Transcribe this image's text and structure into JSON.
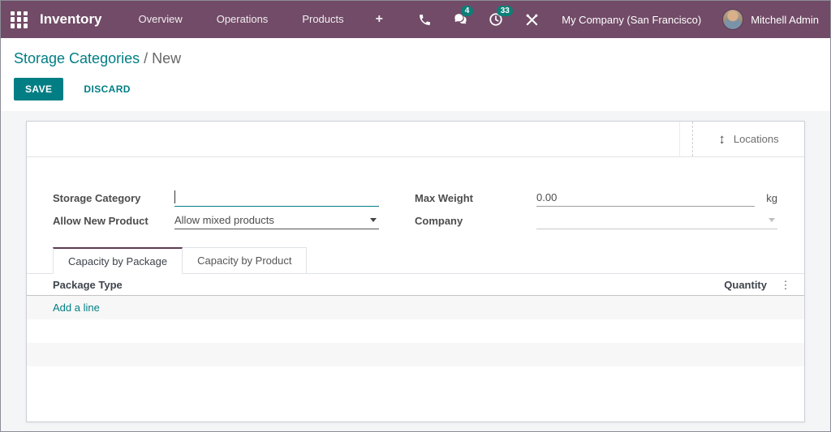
{
  "navbar": {
    "app_name": "Inventory",
    "menu_items": [
      "Overview",
      "Operations",
      "Products"
    ],
    "plus_label": "+",
    "messages_badge": "4",
    "activities_badge": "33",
    "company": "My Company (San Francisco)",
    "user": "Mitchell Admin"
  },
  "control_panel": {
    "breadcrumb": {
      "parent": "Storage Categories",
      "separator": " / ",
      "current": "New"
    },
    "save_label": "SAVE",
    "discard_label": "DISCARD"
  },
  "sheet": {
    "smart_button": {
      "label": "Locations"
    },
    "fields": {
      "storage_category": {
        "label": "Storage Category",
        "value": ""
      },
      "allow_new_product": {
        "label": "Allow New Product",
        "value": "Allow mixed products"
      },
      "max_weight": {
        "label": "Max Weight",
        "value": "0.00",
        "unit": "kg"
      },
      "company": {
        "label": "Company",
        "value": ""
      }
    },
    "tabs": [
      {
        "label": "Capacity by Package"
      },
      {
        "label": "Capacity by Product"
      }
    ],
    "table": {
      "columns": [
        "Package Type",
        "Quantity"
      ],
      "add_line_label": "Add a line"
    }
  },
  "icons": {
    "updown": "↕",
    "optional_columns": "⋮"
  },
  "colors": {
    "navbar_bg": "#714B67",
    "accent_teal": "#017e84",
    "badge_teal": "#0d7e78",
    "content_bg": "#f4f5f7",
    "active_tab_border": "#5d3b52"
  }
}
